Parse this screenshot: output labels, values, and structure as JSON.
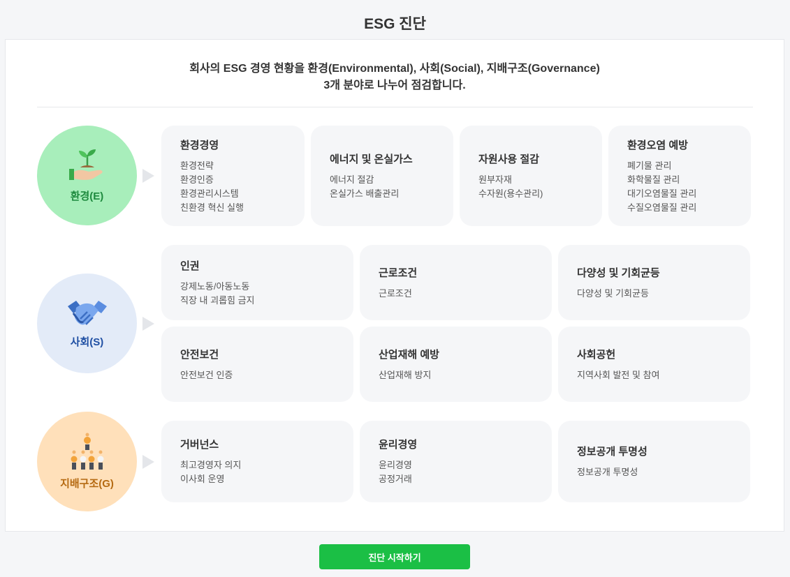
{
  "page": {
    "title": "ESG 진단"
  },
  "intro": {
    "line1": "회사의 ESG 경영 현황을 환경(Environmental), 사회(Social), 지배구조(Governance)",
    "line2": "3개 분야로 나누어 점검합니다."
  },
  "categories": [
    {
      "label": "환경(E)",
      "icon": "plant-in-hand-icon",
      "color": "#a8eebb",
      "cards": [
        {
          "title": "환경경영",
          "items": [
            "환경전략",
            "환경인증",
            "환경관리시스템",
            "친환경 혁신 실행"
          ]
        },
        {
          "title": "에너지 및 온실가스",
          "items": [
            "에너지 절감",
            "온실가스 배출관리"
          ]
        },
        {
          "title": "자원사용 절감",
          "items": [
            "원부자재",
            "수자원(용수관리)"
          ]
        },
        {
          "title": "환경오염 예방",
          "items": [
            "폐기물 관리",
            "화학물질 관리",
            "대기오염물질 관리",
            "수질오염물질 관리"
          ]
        }
      ]
    },
    {
      "label": "사회(S)",
      "icon": "handshake-icon",
      "color": "#e3ebf8",
      "cards": [
        {
          "title": "인권",
          "items": [
            "강제노동/아동노동",
            "직장 내 괴롭힘 금지"
          ]
        },
        {
          "title": "근로조건",
          "items": [
            "근로조건"
          ]
        },
        {
          "title": "다양성 및 기회균등",
          "items": [
            "다양성 및 기회균등"
          ]
        },
        {
          "title": "안전보건",
          "items": [
            "안전보건 인증"
          ]
        },
        {
          "title": "산업재해 예방",
          "items": [
            "산업재해 방지"
          ]
        },
        {
          "title": "사회공헌",
          "items": [
            "지역사회 발전 및 참여"
          ]
        }
      ]
    },
    {
      "label": "지배구조(G)",
      "icon": "organization-chart-icon",
      "color": "#ffe0ba",
      "cards": [
        {
          "title": "거버넌스",
          "items": [
            "최고경영자 의지",
            "이사회 운영"
          ]
        },
        {
          "title": "윤리경영",
          "items": [
            "윤리경영",
            "공정거래"
          ]
        },
        {
          "title": "정보공개 투명성",
          "items": [
            "정보공개 투명성"
          ]
        }
      ]
    }
  ],
  "actions": {
    "start_label": "진단 시작하기",
    "start_color": "#1bbf45"
  }
}
